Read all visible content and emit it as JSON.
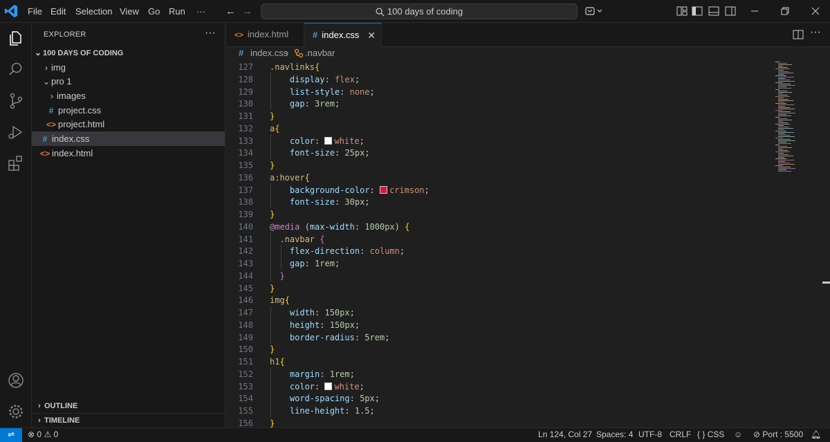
{
  "titlebar": {
    "menu": [
      "File",
      "Edit",
      "Selection",
      "View",
      "Go",
      "Run",
      "···"
    ],
    "search": "100 days of coding",
    "icons": [
      "vscode-logo-icon",
      "back-arrow-icon",
      "forward-arrow-icon",
      "copilot-icon",
      "layout-icon",
      "toggle-sidebar-icon",
      "toggle-panel-icon",
      "toggle-secondary-sidebar-icon",
      "minimize-icon",
      "restore-icon",
      "close-icon"
    ]
  },
  "activitybar": [
    "explorer-icon",
    "search-icon",
    "source-control-icon",
    "run-debug-icon",
    "extensions-icon",
    "account-icon",
    "manage-gear-icon"
  ],
  "sidebar": {
    "title": "EXPLORER",
    "more": "···",
    "root": "100 DAYS OF CODING",
    "items": [
      {
        "label": "img",
        "type": "folder",
        "expanded": false
      },
      {
        "label": "pro 1",
        "type": "folder",
        "expanded": true
      },
      {
        "label": "images",
        "type": "folder",
        "expanded": false
      },
      {
        "label": "project.css",
        "type": "css"
      },
      {
        "label": "project.html",
        "type": "html"
      },
      {
        "label": "index.css",
        "type": "css",
        "selected": true
      },
      {
        "label": "index.html",
        "type": "html"
      }
    ],
    "outline": "OUTLINE",
    "timeline": "TIMELINE"
  },
  "tabs": [
    {
      "label": "index.html",
      "icon": "<>",
      "active": false
    },
    {
      "label": "index.css",
      "icon": "#",
      "active": true
    }
  ],
  "breadcrumb": {
    "file": "index.css",
    "symbol": ".navbar",
    "file_icon": "#"
  },
  "editor": {
    "line_numbers": [
      "127",
      "128",
      "129",
      "130",
      "131",
      "132",
      "133",
      "134",
      "135",
      "136",
      "137",
      "138",
      "139",
      "140",
      "141",
      "142",
      "143",
      "144",
      "145",
      "146",
      "147",
      "148",
      "149",
      "150",
      "151",
      "152",
      "153",
      "154",
      "155",
      "156"
    ],
    "swatch_colors": {
      "white": "#ffffff",
      "crimson": "#dc143c"
    }
  },
  "statusbar": {
    "problems_errors": "0",
    "problems_warnings": "0",
    "position": "Ln 124, Col 27",
    "spaces": "Spaces: 4",
    "encoding": "UTF-8",
    "eol": "CRLF",
    "language": "CSS",
    "port": "Port : 5500"
  },
  "colors": {
    "accent": "#0078d4",
    "background": "#1f1f1f",
    "sidebar": "#181818"
  }
}
